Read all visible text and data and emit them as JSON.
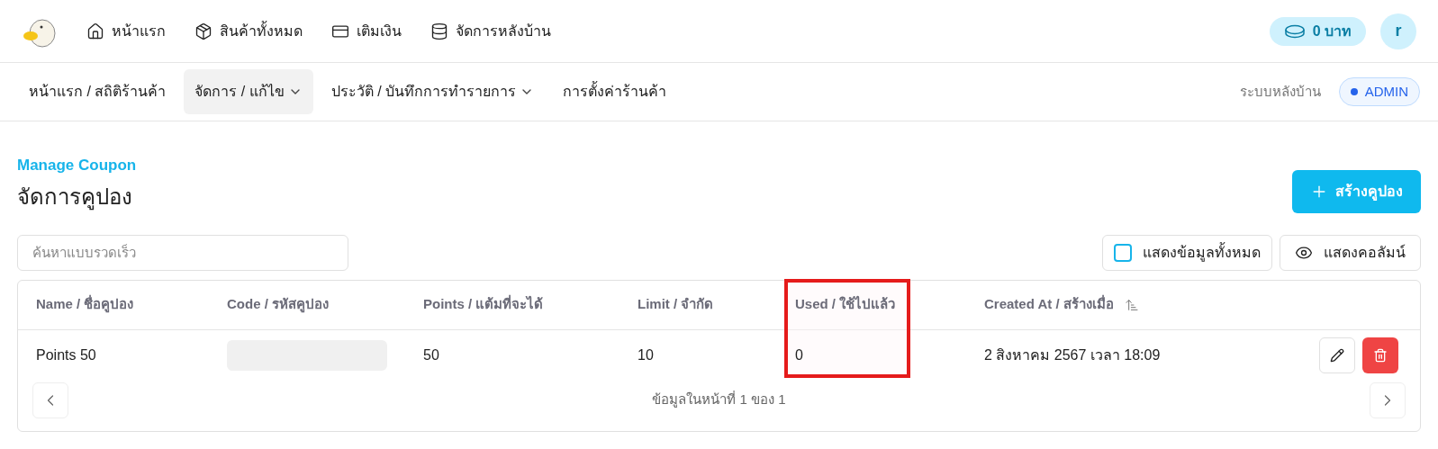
{
  "top_nav": {
    "items": [
      {
        "label": "หน้าแรก"
      },
      {
        "label": "สินค้าทั้งหมด"
      },
      {
        "label": "เติมเงิน"
      },
      {
        "label": "จัดการหลังบ้าน"
      }
    ],
    "balance": "0 บาท",
    "avatar": "r"
  },
  "sub_nav": {
    "items": [
      {
        "label": "หน้าแรก / สถิติร้านค้า",
        "selected": false,
        "dropdown": false
      },
      {
        "label": "จัดการ / แก้ไข",
        "selected": true,
        "dropdown": true
      },
      {
        "label": "ประวัติ / บันทึกการทำรายการ",
        "selected": false,
        "dropdown": true
      },
      {
        "label": "การตั้งค่าร้านค้า",
        "selected": false,
        "dropdown": false
      }
    ],
    "system_label": "ระบบหลังบ้าน",
    "role_badge": "ADMIN"
  },
  "page": {
    "subtitle": "Manage Coupon",
    "title": "จัดการคูปอง",
    "create_button": "สร้างคูปอง"
  },
  "search": {
    "placeholder": "ค้นหาแบบรวดเร็ว"
  },
  "show_all": {
    "label": "แสดงข้อมูลทั้งหมด",
    "checked": false
  },
  "columns_button": "แสดงคอลัมน์",
  "table": {
    "columns": [
      {
        "label": "Name / ชื่อคูปอง",
        "highlighted": false,
        "sortable": false
      },
      {
        "label": "Code / รหัสคูปอง",
        "highlighted": false,
        "sortable": false
      },
      {
        "label": "Points / แต้มที่จะได้",
        "highlighted": false,
        "sortable": false
      },
      {
        "label": "Limit / จำกัด",
        "highlighted": false,
        "sortable": false
      },
      {
        "label": "Used / ใช้ไปแล้ว",
        "highlighted": true,
        "sortable": false
      },
      {
        "label": "Created At / สร้างเมื่อ",
        "highlighted": false,
        "sortable": true
      }
    ],
    "rows": [
      {
        "cells": [
          {
            "kind": "text",
            "value": "Points 50"
          },
          {
            "kind": "redacted"
          },
          {
            "kind": "text",
            "value": "50"
          },
          {
            "kind": "text",
            "value": "10"
          },
          {
            "kind": "text",
            "value": "0"
          },
          {
            "kind": "text",
            "value": "2 สิงหาคม 2567 เวลา 18:09"
          }
        ]
      }
    ]
  },
  "pagination": {
    "info": "ข้อมูลในหน้าที่ 1 ของ 1"
  }
}
